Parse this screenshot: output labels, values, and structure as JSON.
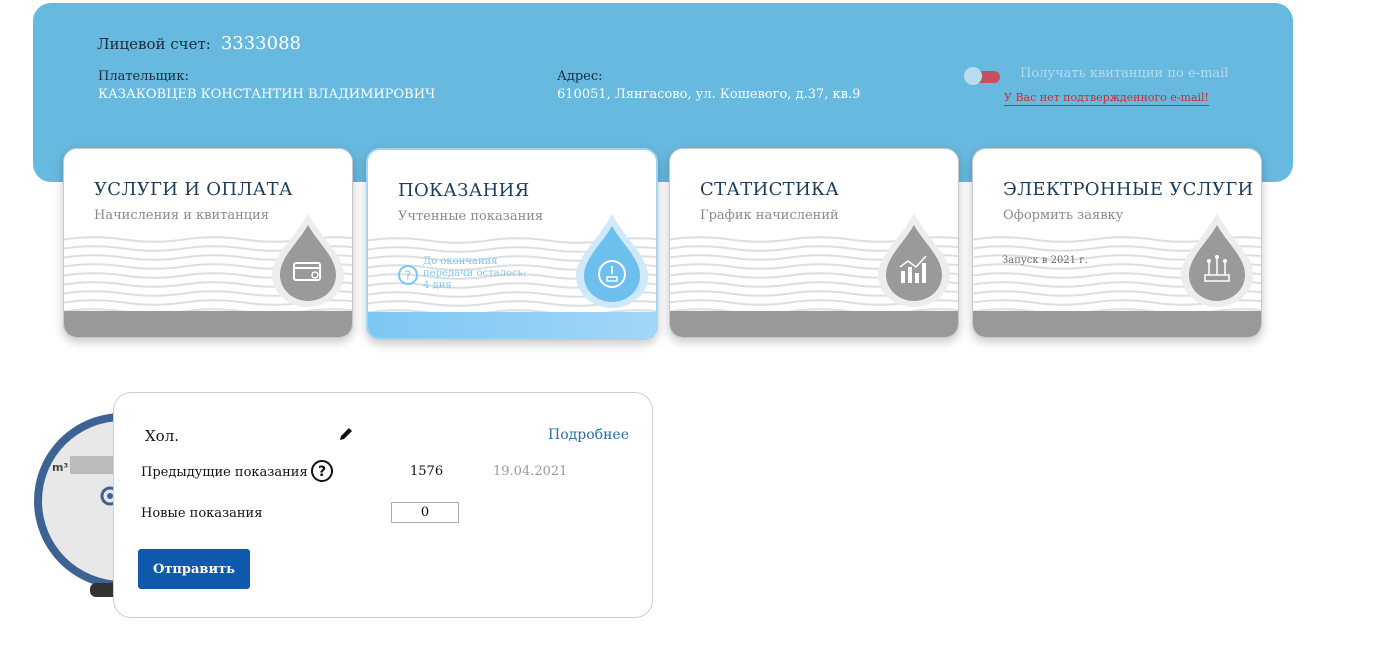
{
  "account": {
    "label": "Лицевой счет:",
    "number": "3333088"
  },
  "payer": {
    "label": "Плательщик:",
    "name": "КАЗАКОВЦЕВ КОНСТАНТИН ВЛАДИМИРОВИЧ"
  },
  "address": {
    "label": "Адрес:",
    "value": "610051, Лянгасово, ул. Кошевого, д.37, кв.9"
  },
  "email": {
    "toggle_label": "Получать квитанции по e-mail",
    "warning": "У Вас нет подтвержденного e-mail!",
    "enabled": false
  },
  "cards": [
    {
      "title": "УСЛУГИ И ОПЛАТА",
      "subtitle": "Начисления и квитанция",
      "icon": "payment-card-icon"
    },
    {
      "title": "ПОКАЗАНИЯ",
      "subtitle": "Учтенные показания",
      "note_line1": "До окончания",
      "note_line2": "передачи осталось:",
      "note_line3": "4 дня",
      "icon": "gauge-icon",
      "active": true
    },
    {
      "title": "СТАТИСТИКА",
      "subtitle": "График начислений",
      "icon": "chart-icon"
    },
    {
      "title": "ЭЛЕКТРОННЫЕ УСЛУГИ",
      "subtitle": "Оформить заявку",
      "note": "Запуск в 2021 г.",
      "icon": "circuit-icon"
    }
  ],
  "meter": {
    "name": "Хол.",
    "more_link": "Подробнее",
    "prev_label": "Предыдущие показания",
    "prev_value": "1576",
    "prev_date": "19.04.2021",
    "new_label": "Новые показания",
    "new_value": "0",
    "submit": "Отправить",
    "unit": "m³"
  },
  "colors": {
    "header": "#68b9df",
    "active_accent": "#7cc7f2",
    "button": "#0f5aad",
    "warning": "#d8262b"
  }
}
